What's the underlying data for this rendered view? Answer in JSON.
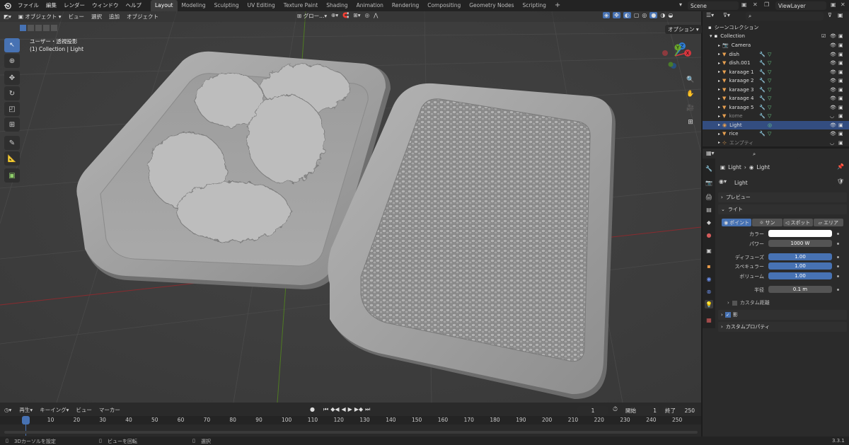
{
  "menu": [
    "ファイル",
    "編集",
    "レンダー",
    "ウィンドウ",
    "ヘルプ"
  ],
  "workspaces": [
    "Layout",
    "Modeling",
    "Sculpting",
    "UV Editing",
    "Texture Paint",
    "Shading",
    "Animation",
    "Rendering",
    "Compositing",
    "Geometry Nodes",
    "Scripting"
  ],
  "active_workspace": "Layout",
  "scene": "Scene",
  "view_layer": "ViewLayer",
  "viewport": {
    "mode": "オブジェクト",
    "menus": [
      "ビュー",
      "選択",
      "追加",
      "オブジェクト"
    ],
    "transform_orient": "グロー...",
    "options": "オプション",
    "view_name": "ユーザー・透視投影",
    "view_info": "(1) Collection | Light"
  },
  "gizmo": {
    "x": "X",
    "y": "Y",
    "z": "Z"
  },
  "timeline": {
    "menus": [
      "再生",
      "キーイング",
      "ビュー",
      "マーカー"
    ],
    "current_frame": "1",
    "start_label": "開始",
    "start": "1",
    "end_label": "終了",
    "end": "250",
    "ticks": [
      "1",
      "10",
      "20",
      "30",
      "40",
      "50",
      "60",
      "70",
      "80",
      "90",
      "100",
      "110",
      "120",
      "130",
      "140",
      "150",
      "160",
      "170",
      "180",
      "190",
      "200",
      "210",
      "220",
      "230",
      "240",
      "250"
    ]
  },
  "status": {
    "left": "3Dカーソルを設定",
    "mid": "ビューを回転",
    "right": "選択",
    "version": "3.3.1"
  },
  "outliner": {
    "scene_collection": "シーンコレクション",
    "collection": "Collection",
    "items": [
      {
        "name": "Camera",
        "icon": "camera",
        "color": "#e89b4a",
        "selected": false,
        "dim": false
      },
      {
        "name": "dish",
        "icon": "mesh",
        "color": "#e8a050",
        "selected": false,
        "dim": false
      },
      {
        "name": "dish.001",
        "icon": "mesh",
        "color": "#e8a050",
        "selected": false,
        "dim": false
      },
      {
        "name": "karaage 1",
        "icon": "mesh",
        "color": "#e8a050",
        "selected": false,
        "dim": false
      },
      {
        "name": "karaage 2",
        "icon": "mesh",
        "color": "#e8a050",
        "selected": false,
        "dim": false
      },
      {
        "name": "karaage 3",
        "icon": "mesh",
        "color": "#e8a050",
        "selected": false,
        "dim": false
      },
      {
        "name": "karaage 4",
        "icon": "mesh",
        "color": "#e8a050",
        "selected": false,
        "dim": false
      },
      {
        "name": "karaage 5",
        "icon": "mesh",
        "color": "#e8a050",
        "selected": false,
        "dim": false
      },
      {
        "name": "kome",
        "icon": "mesh",
        "color": "#e8a050",
        "selected": false,
        "dim": true
      },
      {
        "name": "Light",
        "icon": "light",
        "color": "#e8a050",
        "selected": true,
        "dim": false
      },
      {
        "name": "rice",
        "icon": "mesh",
        "color": "#e8a050",
        "selected": false,
        "dim": false
      },
      {
        "name": "エンプティ",
        "icon": "empty",
        "color": "#e8a050",
        "selected": false,
        "dim": true
      }
    ]
  },
  "properties": {
    "breadcrumb_obj": "Light",
    "breadcrumb_data": "Light",
    "datablock": "Light",
    "sections": {
      "preview": "プレビュー",
      "light": "ライト",
      "shadow": "影",
      "custom": "カスタムプロパティ"
    },
    "light_types": [
      "ポイント",
      "サン",
      "スポット",
      "エリア"
    ],
    "active_type": "ポイント",
    "color_label": "カラー",
    "power_label": "パワー",
    "power": "1000 W",
    "diffuse_label": "ディフューズ",
    "diffuse": "1.00",
    "specular_label": "スペキュラー",
    "specular": "1.00",
    "volume_label": "ボリューム",
    "volume": "1.00",
    "radius_label": "半径",
    "radius": "0.1 m",
    "custom_distance": "カスタム距離"
  },
  "colors": {
    "accent": "#4772b3",
    "selection": "#334d80",
    "x_axis": "#d9363e",
    "y_axis": "#6aa82b",
    "z_axis": "#2f7fd8"
  }
}
